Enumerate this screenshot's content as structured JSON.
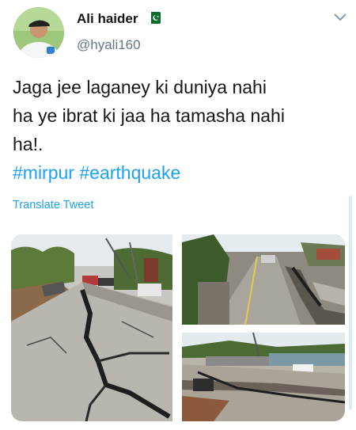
{
  "author": {
    "name": "Ali haider",
    "handle": "@hyali160"
  },
  "tweet": {
    "line1": "Jaga jee laganey ki duniya nahi",
    "line2": "ha ye ibrat ki jaa ha tamasha nahi",
    "line3": "ha!.",
    "hashtags": [
      "#mirpur",
      "#earthquake"
    ]
  },
  "translate_label": "Translate Tweet",
  "icons": {
    "flag": "pakistan-flag-icon",
    "menu": "chevron-down-icon"
  },
  "colors": {
    "link": "#1da1f2",
    "text": "#14171a",
    "muted": "#657786"
  }
}
